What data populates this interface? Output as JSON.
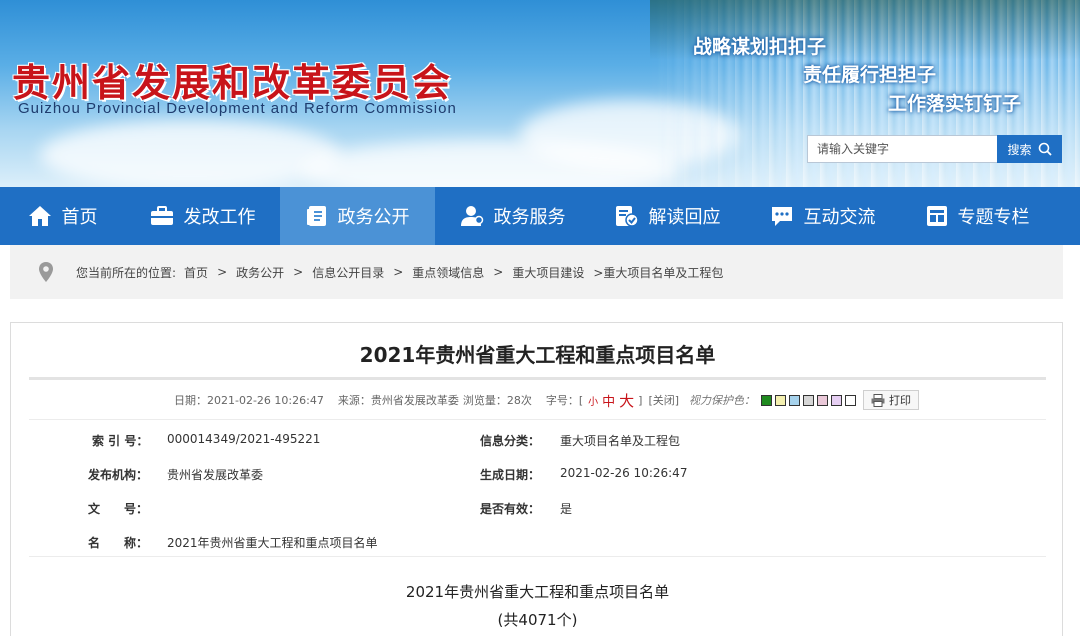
{
  "header": {
    "title_cn": "贵州省发展和改革委员会",
    "title_en": "Guizhou Provincial Development and Reform Commission",
    "slogans": [
      "战略谋划扣扣子",
      "责任履行担担子",
      "工作落实钉钉子"
    ],
    "search": {
      "placeholder": "请输入关键字",
      "button_label": "搜索"
    }
  },
  "nav": {
    "items": [
      {
        "label": "首页",
        "icon": "home-icon"
      },
      {
        "label": "发改工作",
        "icon": "briefcase-icon"
      },
      {
        "label": "政务公开",
        "icon": "document-icon",
        "active": true
      },
      {
        "label": "政务服务",
        "icon": "user-service-icon"
      },
      {
        "label": "解读回应",
        "icon": "check-doc-icon"
      },
      {
        "label": "互动交流",
        "icon": "chat-icon"
      },
      {
        "label": "专题专栏",
        "icon": "grid-icon"
      }
    ]
  },
  "breadcrumb": {
    "prefix": "您当前所在的位置:",
    "items": [
      "首页",
      "政务公开",
      "信息公开目录",
      "重点领域信息",
      "重大项目建设",
      ">重大项目名单及工程包"
    ]
  },
  "article": {
    "title": "2021年贵州省重大工程和重点项目名单",
    "meta": {
      "date": "日期：2021-02-26 10:26:47",
      "source": "来源：贵州省发展改革委",
      "views": "浏览量：28次",
      "font_label": "字号：[",
      "font_small": "小",
      "font_medium": "中",
      "font_large": "大",
      "font_close": "]",
      "close": "[关闭]",
      "eye_label": "视力保护色：",
      "swatches": [
        "#1f8a1f",
        "#f4f0b0",
        "#a6d2ec",
        "#d6d6d6",
        "#eac8d8",
        "#e6cff3",
        "#ffffff"
      ],
      "print_label": "打印"
    },
    "info": {
      "index_label": "索 引 号：",
      "index_value": "000014349/2021-495221",
      "category_label": "信息分类：",
      "category_value": "重大项目名单及工程包",
      "publisher_label": "发布机构：",
      "publisher_value": "贵州省发展改革委",
      "date_label": "生成日期：",
      "date_value": "2021-02-26 10:26:47",
      "doc_no_label": "文　　号：",
      "doc_no_value": "",
      "valid_label": "是否有效：",
      "valid_value": "是",
      "name_label": "名　　称：",
      "name_value": "2021年贵州省重大工程和重点项目名单"
    },
    "body_title": "2021年贵州省重大工程和重点项目名单",
    "body_subtitle": "(共4071个)"
  }
}
